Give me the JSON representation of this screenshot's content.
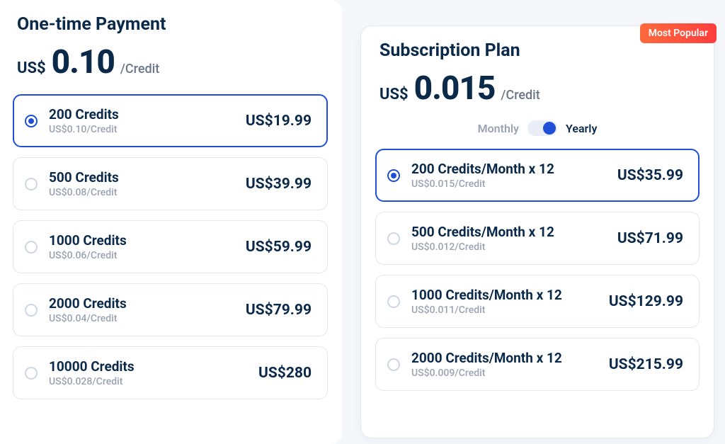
{
  "onetime": {
    "title": "One-time Payment",
    "currency": "US$",
    "price": "0.10",
    "per": "/Credit",
    "selected_index": 0,
    "options": [
      {
        "title": "200 Credits",
        "sub": "US$0.10/Credit",
        "price": "US$19.99"
      },
      {
        "title": "500 Credits",
        "sub": "US$0.08/Credit",
        "price": "US$39.99"
      },
      {
        "title": "1000 Credits",
        "sub": "US$0.06/Credit",
        "price": "US$59.99"
      },
      {
        "title": "2000 Credits",
        "sub": "US$0.04/Credit",
        "price": "US$79.99"
      },
      {
        "title": "10000 Credits",
        "sub": "US$0.028/Credit",
        "price": "US$280"
      }
    ]
  },
  "subscription": {
    "badge": "Most Popular",
    "title": "Subscription Plan",
    "currency": "US$",
    "price": "0.015",
    "per": "/Credit",
    "toggle": {
      "left": "Monthly",
      "right": "Yearly",
      "active": "right"
    },
    "selected_index": 0,
    "options": [
      {
        "title": "200 Credits/Month x 12",
        "sub": "US$0.015/Credit",
        "price": "US$35.99"
      },
      {
        "title": "500 Credits/Month x 12",
        "sub": "US$0.012/Credit",
        "price": "US$71.99"
      },
      {
        "title": "1000 Credits/Month x 12",
        "sub": "US$0.011/Credit",
        "price": "US$129.99"
      },
      {
        "title": "2000 Credits/Month x 12",
        "sub": "US$0.009/Credit",
        "price": "US$215.99"
      }
    ]
  }
}
